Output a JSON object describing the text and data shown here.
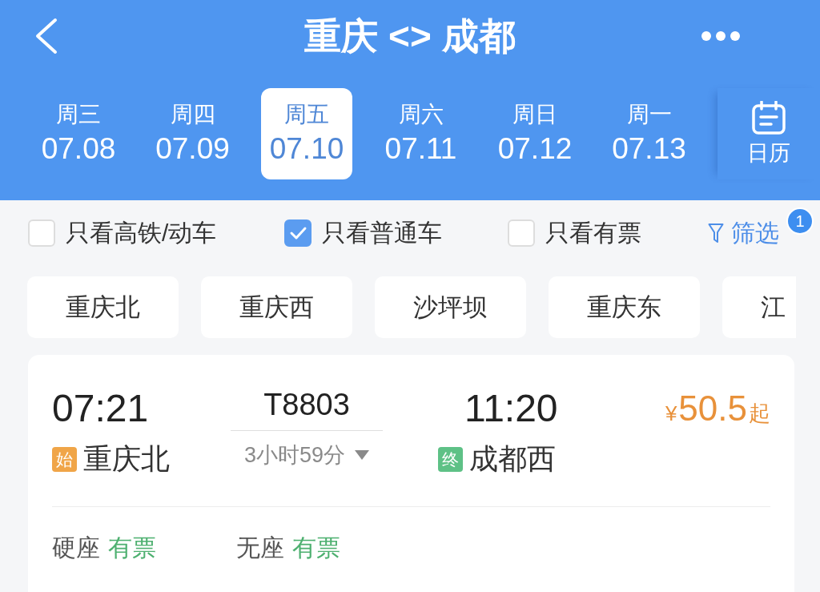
{
  "header": {
    "title": "重庆 <> 成都"
  },
  "date_tabs": [
    {
      "weekday": "周三",
      "date": "07.08",
      "selected": false
    },
    {
      "weekday": "周四",
      "date": "07.09",
      "selected": false
    },
    {
      "weekday": "周五",
      "date": "07.10",
      "selected": true
    },
    {
      "weekday": "周六",
      "date": "07.11",
      "selected": false
    },
    {
      "weekday": "周日",
      "date": "07.12",
      "selected": false
    },
    {
      "weekday": "周一",
      "date": "07.13",
      "selected": false
    }
  ],
  "calendar_button": {
    "label": "日历"
  },
  "filters": [
    {
      "label": "只看高铁/动车",
      "checked": false
    },
    {
      "label": "只看普通车",
      "checked": true
    },
    {
      "label": "只看有票",
      "checked": false
    }
  ],
  "filter_button": {
    "label": "筛选",
    "badge": "1"
  },
  "stations": [
    {
      "label": "重庆北",
      "selected": false
    },
    {
      "label": "重庆西",
      "selected": false
    },
    {
      "label": "沙坪坝",
      "selected": false
    },
    {
      "label": "重庆东",
      "selected": false
    },
    {
      "label": "江",
      "selected": false
    }
  ],
  "trains": [
    {
      "depart_time": "07:21",
      "depart_tag": "始",
      "depart_station": "重庆北",
      "train_number": "T8803",
      "duration": "3小时59分",
      "arrive_time": "11:20",
      "arrive_tag": "终",
      "arrive_station": "成都西",
      "price": {
        "currency": "¥",
        "amount": "50.5",
        "suffix": "起"
      },
      "seats": [
        {
          "class": "硬座",
          "status": "有票"
        },
        {
          "class": "无座",
          "status": "有票"
        }
      ]
    }
  ]
}
